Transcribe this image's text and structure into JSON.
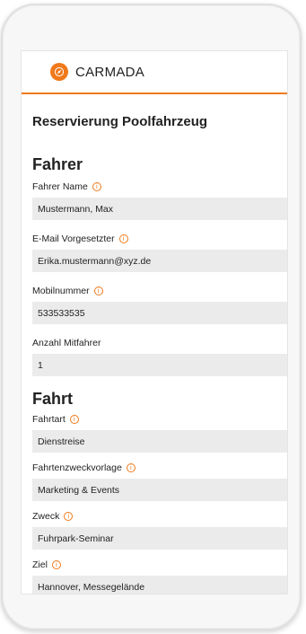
{
  "brand": {
    "name": "CARMADA",
    "accent": "#f07a1b"
  },
  "page": {
    "title": "Reservierung Poolfahrzeug"
  },
  "sections": {
    "fahrer": {
      "title": "Fahrer",
      "fields": [
        {
          "label": "Fahrer Name",
          "value": "Mustermann, Max",
          "info": true
        },
        {
          "label": "E-Mail Vorgesetzter",
          "value": "Erika.mustermann@xyz.de",
          "info": true
        },
        {
          "label": "Mobilnummer",
          "value": "533533535",
          "info": true
        },
        {
          "label": "Anzahl Mitfahrer",
          "value": "1",
          "info": false
        }
      ]
    },
    "fahrt": {
      "title": "Fahrt",
      "fields": [
        {
          "label": "Fahrtart",
          "value": "Dienstreise",
          "info": true
        },
        {
          "label": "Fahrtenzweckvorlage",
          "value": "Marketing & Events",
          "info": true
        },
        {
          "label": "Zweck",
          "value": "Fuhrpark-Seminar",
          "info": true
        },
        {
          "label": "Ziel",
          "value": "Hannover, Messegelände",
          "info": true
        }
      ]
    }
  },
  "icons": {
    "info": "info-circle-icon",
    "logo": "compass-logo-icon"
  }
}
